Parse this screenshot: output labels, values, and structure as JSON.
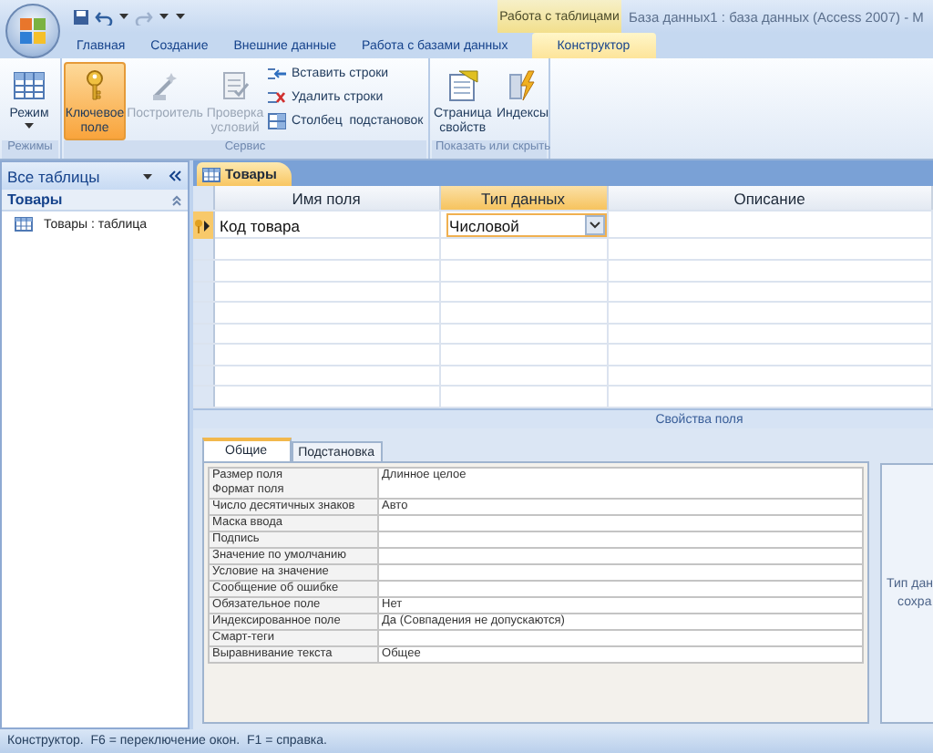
{
  "title_bar": {
    "context_label": "Работа с таблицами",
    "title": "База данных1 : база данных (Access 2007) - M"
  },
  "ribbon_tabs": [
    {
      "label": "Главная",
      "selected": false
    },
    {
      "label": "Создание",
      "selected": false
    },
    {
      "label": "Внешние данные",
      "selected": false
    },
    {
      "label": "Работа с базами данных",
      "selected": false
    },
    {
      "label": "Конструктор",
      "selected": true
    }
  ],
  "ribbon_groups": [
    {
      "label": "Режимы",
      "items": [
        {
          "kind": "large",
          "label": "Режим",
          "selected": false,
          "disabled": false,
          "dropdown": true
        }
      ]
    },
    {
      "label": "Сервис",
      "items": [
        {
          "kind": "large",
          "label": "Ключевое поле",
          "selected": true,
          "disabled": false
        },
        {
          "kind": "large",
          "label": "Построитель",
          "selected": false,
          "disabled": true
        },
        {
          "kind": "large",
          "label": "Проверка условий",
          "selected": false,
          "disabled": true
        },
        {
          "kind": "small",
          "label": "Вставить строки",
          "selected": false,
          "disabled": false
        },
        {
          "kind": "small",
          "label": "Удалить строки",
          "selected": false,
          "disabled": false
        },
        {
          "kind": "small",
          "label": "Столбец  подстановок",
          "selected": false,
          "disabled": false
        }
      ]
    },
    {
      "label": "Показать или скрыть",
      "items": [
        {
          "kind": "large",
          "label": "Страница свойств",
          "selected": false,
          "disabled": false
        },
        {
          "kind": "large",
          "label": "Индексы",
          "selected": false,
          "disabled": false
        }
      ]
    }
  ],
  "navigation": {
    "header": "Все таблицы",
    "groups": [
      {
        "label": "Товары",
        "expanded": true,
        "items": [
          {
            "label": "Товары : таблица",
            "selected": false
          }
        ]
      }
    ]
  },
  "document_tabs": [
    {
      "label": "Товары",
      "selected": true
    }
  ],
  "design_grid": {
    "columns": [
      {
        "label": "Имя поля",
        "selected": false
      },
      {
        "label": "Тип данных",
        "selected": true
      },
      {
        "label": "Описание",
        "selected": false
      }
    ],
    "rows": [
      {
        "name": "Код товара",
        "type": "Числовой",
        "selected": true,
        "primary_key": true
      }
    ]
  },
  "field_properties": {
    "title": "Свойства поля",
    "tabs": [
      {
        "label": "Общие",
        "selected": true
      },
      {
        "label": "Подстановка",
        "selected": false
      }
    ],
    "rows": [
      {
        "label": "Размер поля",
        "value": "Длинное целое"
      },
      {
        "label": "Формат поля"
      },
      {
        "label": "Число десятичных знаков",
        "value": "Авто"
      },
      {
        "label": "Маска ввода"
      },
      {
        "label": "Подпись"
      },
      {
        "label": "Значение по умолчанию"
      },
      {
        "label": "Условие на значение"
      },
      {
        "label": "Сообщение об ошибке"
      },
      {
        "label": "Обязательное поле",
        "value": "Нет"
      },
      {
        "label": "Индексированное поле",
        "value": "Да (Совпадения не допускаются)"
      },
      {
        "label": "Смарт-теги"
      },
      {
        "label": "Выравнивание текста",
        "value": "Общее"
      }
    ],
    "help_lines": [
      "Тип дан",
      "сохра"
    ]
  },
  "status_bar": {
    "text": "Конструктор.  F6 = переключение окон.  F1 = справка."
  }
}
